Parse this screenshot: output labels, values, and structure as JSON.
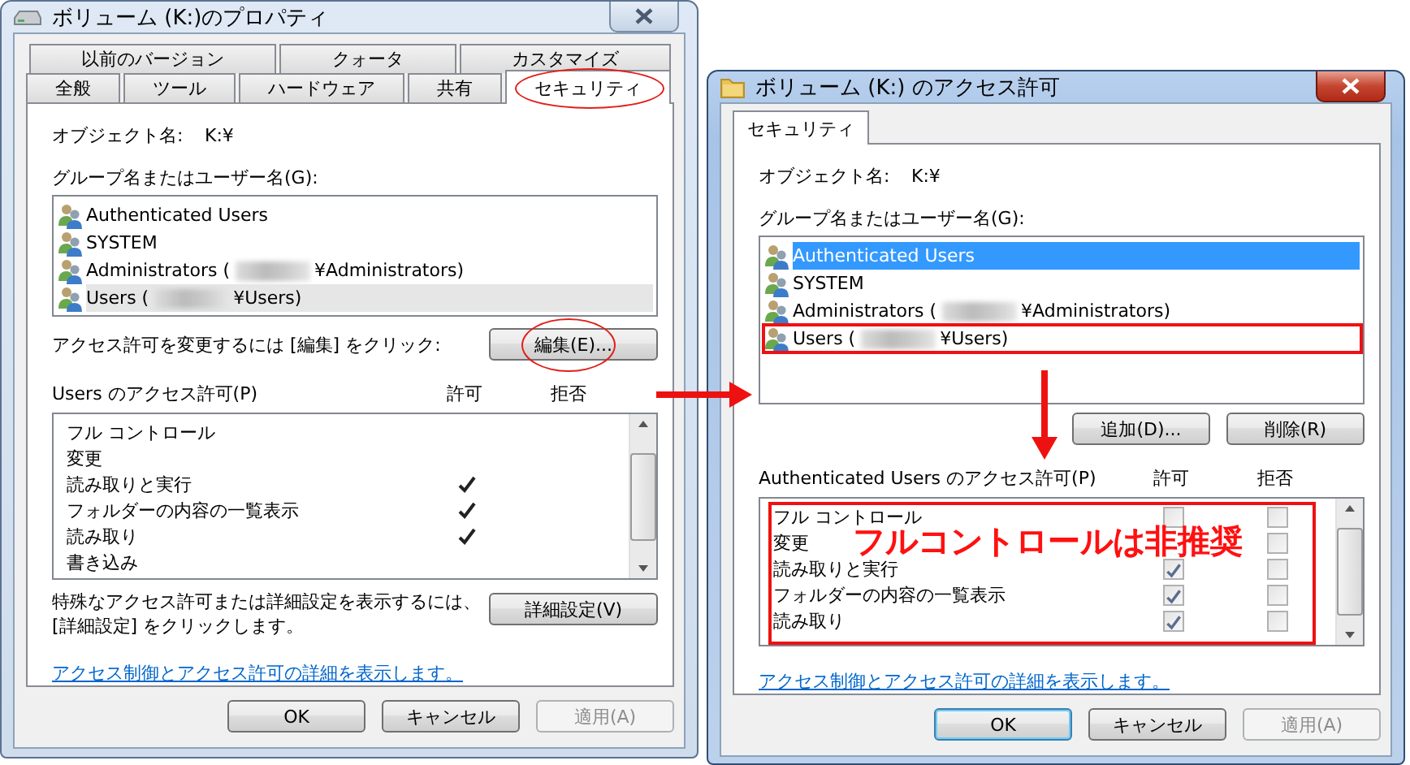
{
  "properties_dialog": {
    "title": "ボリューム (K:)のプロパティ",
    "active": false,
    "tab_rows": [
      [
        {
          "label": "以前のバージョン",
          "selected": false,
          "circled": false
        },
        {
          "label": "クォータ",
          "selected": false,
          "circled": false
        },
        {
          "label": "カスタマイズ",
          "selected": false,
          "circled": false
        }
      ],
      [
        {
          "label": "全般",
          "selected": false,
          "circled": false
        },
        {
          "label": "ツール",
          "selected": false,
          "circled": false
        },
        {
          "label": "ハードウェア",
          "selected": false,
          "circled": false
        },
        {
          "label": "共有",
          "selected": false,
          "circled": false
        },
        {
          "label": "セキュリティ",
          "selected": true,
          "circled": true
        }
      ]
    ],
    "object_label": "オブジェクト名:",
    "object_value": "K:¥",
    "group_label": "グループ名またはユーザー名(G):",
    "principals": [
      {
        "name": "Authenticated Users",
        "selected": false,
        "boxed": false
      },
      {
        "name": "SYSTEM",
        "selected": false,
        "boxed": false
      },
      {
        "name": "Administrators (",
        "redacted": true,
        "suffix": "¥Administrators)",
        "selected": false,
        "boxed": false
      },
      {
        "name": "Users (",
        "redacted": true,
        "suffix": "¥Users)",
        "selected": true,
        "boxed": false
      }
    ],
    "edit_hint": "アクセス許可を変更するには [編集] をクリック:",
    "edit_button": {
      "label": "編集(E)...",
      "circled": true
    },
    "permissions_label": "Users のアクセス許可(P)",
    "allow_header": "許可",
    "deny_header": "拒否",
    "permissions": [
      {
        "name": "フル コントロール",
        "kind": "tick",
        "allow": false,
        "deny": false
      },
      {
        "name": "変更",
        "kind": "tick",
        "allow": false,
        "deny": false
      },
      {
        "name": "読み取りと実行",
        "kind": "tick",
        "allow": true,
        "deny": false
      },
      {
        "name": "フォルダーの内容の一覧表示",
        "kind": "tick",
        "allow": true,
        "deny": false
      },
      {
        "name": "読み取り",
        "kind": "tick",
        "allow": true,
        "deny": false
      },
      {
        "name": "書き込み",
        "kind": "tick",
        "allow": false,
        "deny": false
      }
    ],
    "advanced_hint": "特殊なアクセス許可または詳細設定を表示するには、\n[詳細設定] をクリックします。",
    "advanced_button": "詳細設定(V)",
    "link": "アクセス制御とアクセス許可の詳細を表示します。",
    "buttons": [
      {
        "label": "OK",
        "default": false,
        "disabled": false
      },
      {
        "label": "キャンセル",
        "default": false,
        "disabled": false
      },
      {
        "label": "適用(A)",
        "default": false,
        "disabled": true
      }
    ]
  },
  "permissions_dialog": {
    "title": "ボリューム (K:) のアクセス許可",
    "active": true,
    "tab_rows": [
      [
        {
          "label": "セキュリティ",
          "selected": true,
          "circled": false
        }
      ]
    ],
    "object_label": "オブジェクト名:",
    "object_value": "K:¥",
    "group_label": "グループ名またはユーザー名(G):",
    "principals": [
      {
        "name": "Authenticated Users",
        "selected": true,
        "boxed": false
      },
      {
        "name": "SYSTEM",
        "selected": false,
        "boxed": false
      },
      {
        "name": "Administrators (",
        "redacted": true,
        "suffix": "¥Administrators)",
        "selected": false,
        "boxed": false
      },
      {
        "name": "Users (",
        "redacted": true,
        "suffix": "¥Users)",
        "selected": false,
        "boxed": true
      }
    ],
    "add_button": "追加(D)...",
    "remove_button": "削除(R)",
    "permissions_label": "Authenticated Users のアクセス許可(P)",
    "allow_header": "許可",
    "deny_header": "拒否",
    "permissions": [
      {
        "name": "フル コントロール",
        "kind": "checkbox",
        "allow": false,
        "deny": false,
        "disabled": true
      },
      {
        "name": "変更",
        "kind": "checkbox",
        "deny": false,
        "disabled": true
      },
      {
        "name": "読み取りと実行",
        "kind": "checkbox",
        "allow": true,
        "deny": false,
        "disabled": true
      },
      {
        "name": "フォルダーの内容の一覧表示",
        "kind": "checkbox",
        "allow": true,
        "deny": false,
        "disabled": true
      },
      {
        "name": "読み取り",
        "kind": "checkbox",
        "allow": true,
        "deny": false,
        "disabled": true
      }
    ],
    "permissions_boxed": true,
    "permissions_note": "フルコントロールは非推奨",
    "link": "アクセス制御とアクセス許可の詳細を表示します。",
    "buttons": [
      {
        "label": "OK",
        "default": true,
        "disabled": false
      },
      {
        "label": "キャンセル",
        "default": false,
        "disabled": false
      },
      {
        "label": "適用(A)",
        "default": false,
        "disabled": true
      }
    ]
  }
}
